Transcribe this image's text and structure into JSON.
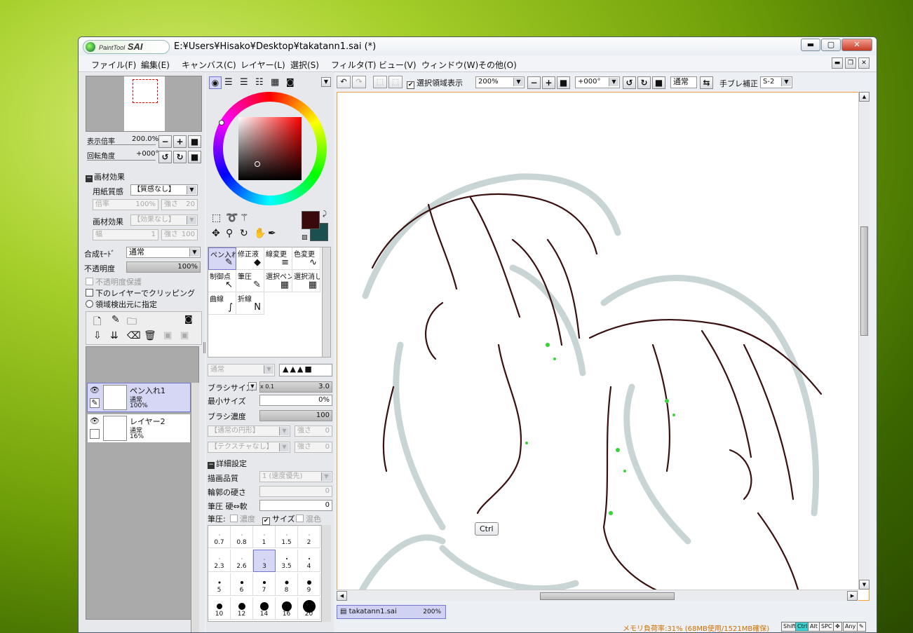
{
  "window": {
    "title": "E:¥Users¥Hisako¥Desktop¥takatann1.sai (*)",
    "logo_small": "PaintTool",
    "logo_big": "SAI",
    "min": "▬",
    "max": "▢",
    "close": "✕"
  },
  "menu": [
    "ファイル(F)",
    "編集(E)",
    "キャンバス(C)",
    "レイヤー(L)",
    "選択(S)",
    "フィルタ(T)",
    "ビュー(V)",
    "ウィンドウ(W)",
    "その他(O)"
  ],
  "nav": {
    "zoom_label": "表示倍率",
    "zoom_value": "200.0%",
    "rot_label": "回転角度",
    "rot_value": "+000°"
  },
  "texture": {
    "header": "画材効果",
    "paper_label": "用紙質感",
    "paper_value": "【質感なし】",
    "mag_label": "倍率",
    "mag_value": "100%",
    "str_label": "強さ",
    "str_value": "20",
    "effect_label": "画材効果",
    "effect_value": "【効果なし】",
    "width_label": "幅",
    "width_value": "1",
    "str2_label": "強さ",
    "str2_value": "100"
  },
  "layer_props": {
    "blend_label": "合成ﾓｰﾄﾞ",
    "blend_value": "通常",
    "opacity_label": "不透明度",
    "opacity_value": "100%",
    "preserve": "不透明度保護",
    "clip": "下のレイヤーでクリッピング",
    "source": "領域検出元に指定"
  },
  "layers": [
    {
      "name": "ペン入れ1",
      "mode": "通常",
      "opacity": "100%"
    },
    {
      "name": "レイヤー2",
      "mode": "通常",
      "opacity": "16%"
    }
  ],
  "tools": [
    "ペン入れ",
    "修正液",
    "線変更",
    "色変更",
    "制御点",
    "筆圧",
    "選択ペン",
    "選択消し",
    "曲線",
    "折線"
  ],
  "tool_icons": [
    "✎",
    "◆",
    "≡",
    "∿",
    "↖",
    "✎",
    "▦",
    "▦",
    "∫",
    "N"
  ],
  "brush": {
    "mode_value": "通常",
    "size_label": "ブラシサイズ",
    "size_mult": "x 0.1",
    "size_value": "3.0",
    "min_label": "最小サイズ",
    "min_value": "0%",
    "density_label": "ブラシ濃度",
    "density_value": "100",
    "shape_value": "【通常の円形】",
    "shape_str_label": "強さ",
    "shape_str_value": "0",
    "tex_value": "【テクスチャなし】",
    "tex_str_label": "強さ",
    "tex_str_value": "0",
    "detail_header": "詳細設定",
    "quality_label": "描画品質",
    "quality_value": "1 (速度優先)",
    "hard_label": "輪郭の硬さ",
    "hard_value": "0",
    "press_label": "筆圧 硬⇔軟",
    "press_value": "0",
    "pressure_label": "筆圧:",
    "p_density": "濃度",
    "p_size": "サイズ",
    "p_blend": "混色"
  },
  "brush_sizes": [
    "0.7",
    "0.8",
    "1",
    "1.5",
    "2",
    "2.3",
    "2.6",
    "3",
    "3.5",
    "4",
    "5",
    "6",
    "7",
    "8",
    "9",
    "10",
    "12",
    "14",
    "16",
    "20"
  ],
  "brush_dot_sizes": [
    1,
    1,
    1,
    1,
    1,
    1,
    1,
    1,
    2,
    2,
    3,
    4,
    4,
    5,
    6,
    8,
    10,
    12,
    14,
    18
  ],
  "canvas_toolbar": {
    "show_selection": "選択領域表示",
    "zoom": "200%",
    "rotation": "+000°",
    "mode": "通常",
    "stabilizer_label": "手ブレ補正",
    "stabilizer_value": "S-2"
  },
  "tooltip": "Ctrl",
  "tab": {
    "name": "takatann1.sai",
    "zoom": "200%"
  },
  "status": {
    "memory": "メモリ負荷率:31% (68MB使用/1521MB確保)",
    "mods": [
      "Shift",
      "Ctrl",
      "Alt",
      "SPC",
      "✥",
      "Any",
      "✎"
    ]
  },
  "colors": {
    "primary": "#3a0a0a",
    "secondary": "#1a5050",
    "accent_select": "#d5d7f5"
  }
}
